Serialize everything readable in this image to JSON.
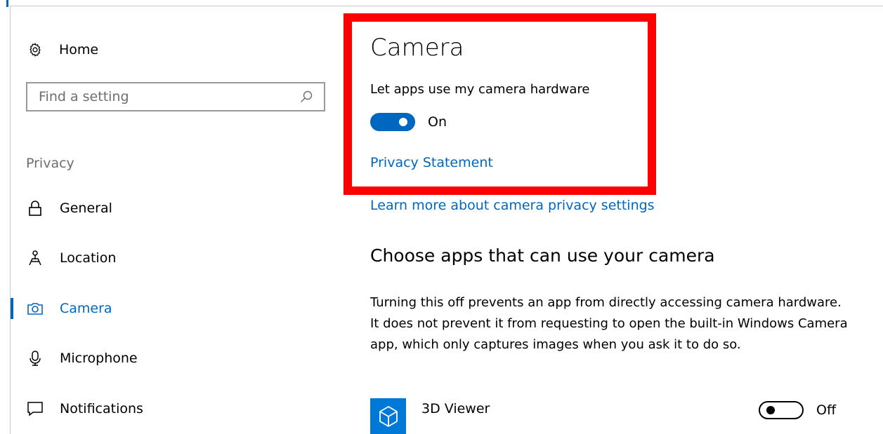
{
  "sidebar": {
    "home_label": "Home",
    "search_placeholder": "Find a setting",
    "section_header": "Privacy",
    "items": [
      {
        "label": "General",
        "icon": "lock-icon",
        "active": false
      },
      {
        "label": "Location",
        "icon": "location-icon",
        "active": false
      },
      {
        "label": "Camera",
        "icon": "camera-icon",
        "active": true
      },
      {
        "label": "Microphone",
        "icon": "microphone-icon",
        "active": false
      },
      {
        "label": "Notifications",
        "icon": "notifications-icon",
        "active": false
      }
    ]
  },
  "main": {
    "title": "Camera",
    "setting_label": "Let apps use my camera hardware",
    "toggle_state": "On",
    "privacy_link": "Privacy Statement",
    "learn_more_link": "Learn more about camera privacy settings",
    "apps_section_title": "Choose apps that can use your camera",
    "description": "Turning this off prevents an app from directly accessing camera hardware. It does not prevent it from requesting to open the built-in Windows Camera app, which only captures images when you ask it to do so.",
    "apps": [
      {
        "name": "3D Viewer",
        "icon": "cube-icon",
        "toggle_state": "Off"
      }
    ]
  },
  "colors": {
    "accent": "#0067c0",
    "highlight": "#fe0000",
    "app_tile": "#0078d7"
  }
}
